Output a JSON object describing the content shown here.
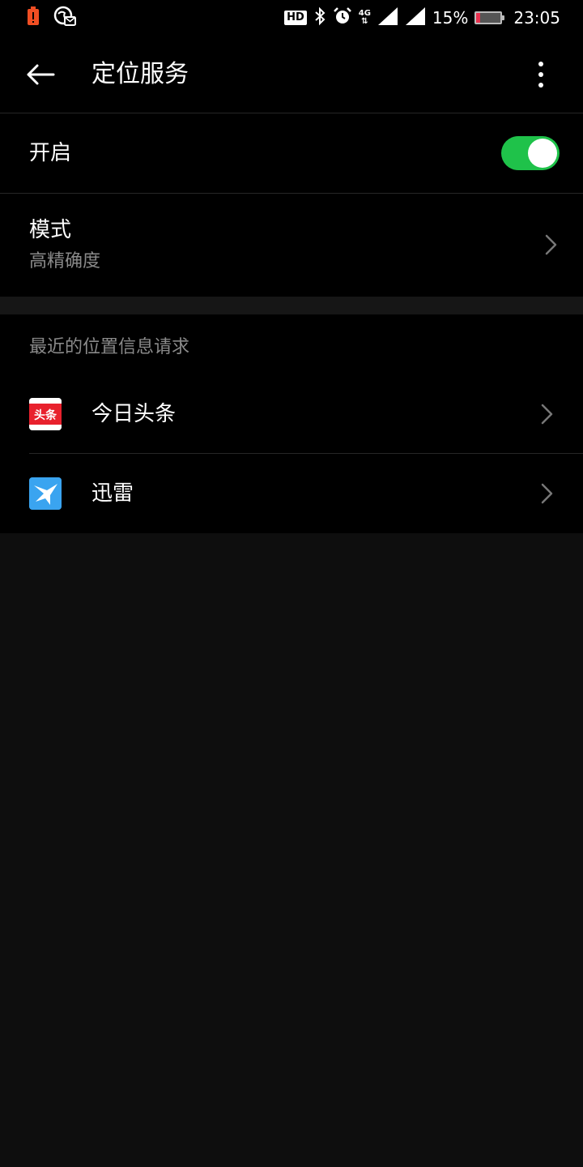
{
  "status_bar": {
    "battery_percent": "15%",
    "battery_level": 0.15,
    "time": "23:05",
    "hd_label": "HD",
    "net_label": "4G"
  },
  "app_bar": {
    "title": "定位服务"
  },
  "settings": {
    "enable_label": "开启",
    "enabled": true,
    "mode_label": "模式",
    "mode_value": "高精确度"
  },
  "recent": {
    "header": "最近的位置信息请求",
    "apps": [
      {
        "name": "今日头条",
        "icon_text": "头条",
        "icon": "toutiao-icon",
        "color": "#e8212d"
      },
      {
        "name": "迅雷",
        "icon": "xunlei-bird-icon",
        "color": "#3aa4f0"
      }
    ]
  },
  "colors": {
    "toggle_on": "#1fc24a",
    "battery_low": "#e8314f",
    "alert": "#f04e23"
  }
}
